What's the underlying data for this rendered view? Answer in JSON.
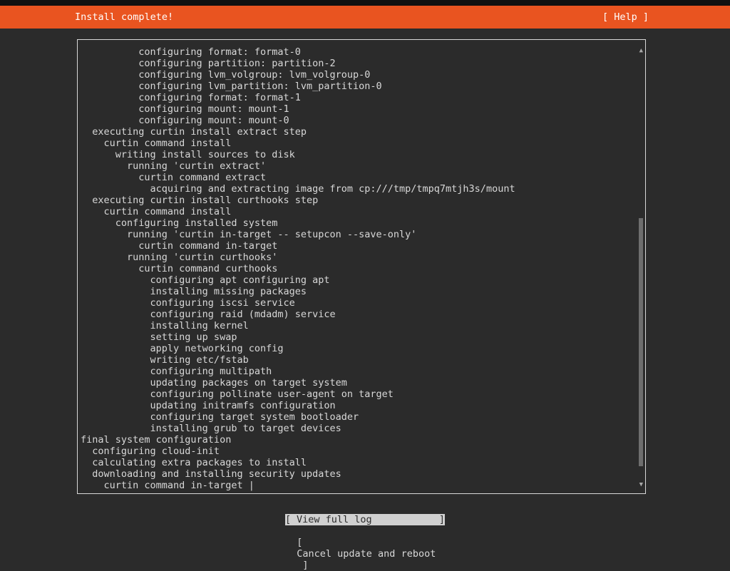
{
  "header": {
    "title": "Install complete!",
    "help_label": "[ Help ]"
  },
  "log": {
    "lines": [
      "          configuring format: format-0",
      "          configuring partition: partition-2",
      "          configuring lvm_volgroup: lvm_volgroup-0",
      "          configuring lvm_partition: lvm_partition-0",
      "          configuring format: format-1",
      "          configuring mount: mount-1",
      "          configuring mount: mount-0",
      "  executing curtin install extract step",
      "    curtin command install",
      "      writing install sources to disk",
      "        running 'curtin extract'",
      "          curtin command extract",
      "            acquiring and extracting image from cp:///tmp/tmpq7mtjh3s/mount",
      "  executing curtin install curthooks step",
      "    curtin command install",
      "      configuring installed system",
      "        running 'curtin in-target -- setupcon --save-only'",
      "          curtin command in-target",
      "        running 'curtin curthooks'",
      "          curtin command curthooks",
      "            configuring apt configuring apt",
      "            installing missing packages",
      "            configuring iscsi service",
      "            configuring raid (mdadm) service",
      "            installing kernel",
      "            setting up swap",
      "            apply networking config",
      "            writing etc/fstab",
      "            configuring multipath",
      "            updating packages on target system",
      "            configuring pollinate user-agent on target",
      "            updating initramfs configuration",
      "            configuring target system bootloader",
      "            installing grub to target devices",
      "final system configuration",
      "  configuring cloud-init",
      "  calculating extra packages to install",
      "  downloading and installing security updates",
      "    curtin command in-target |"
    ],
    "scroll_up_glyph": "▲",
    "scroll_down_glyph": "▼"
  },
  "buttons": {
    "view_log": {
      "open": "[",
      "label": "View full log",
      "close": "]"
    },
    "cancel_reboot": {
      "open": "[",
      "label": "Cancel update and reboot",
      "close": "]"
    }
  },
  "colors": {
    "accent": "#e95420",
    "background": "#2b2b2b",
    "text": "#d8d8d8"
  }
}
